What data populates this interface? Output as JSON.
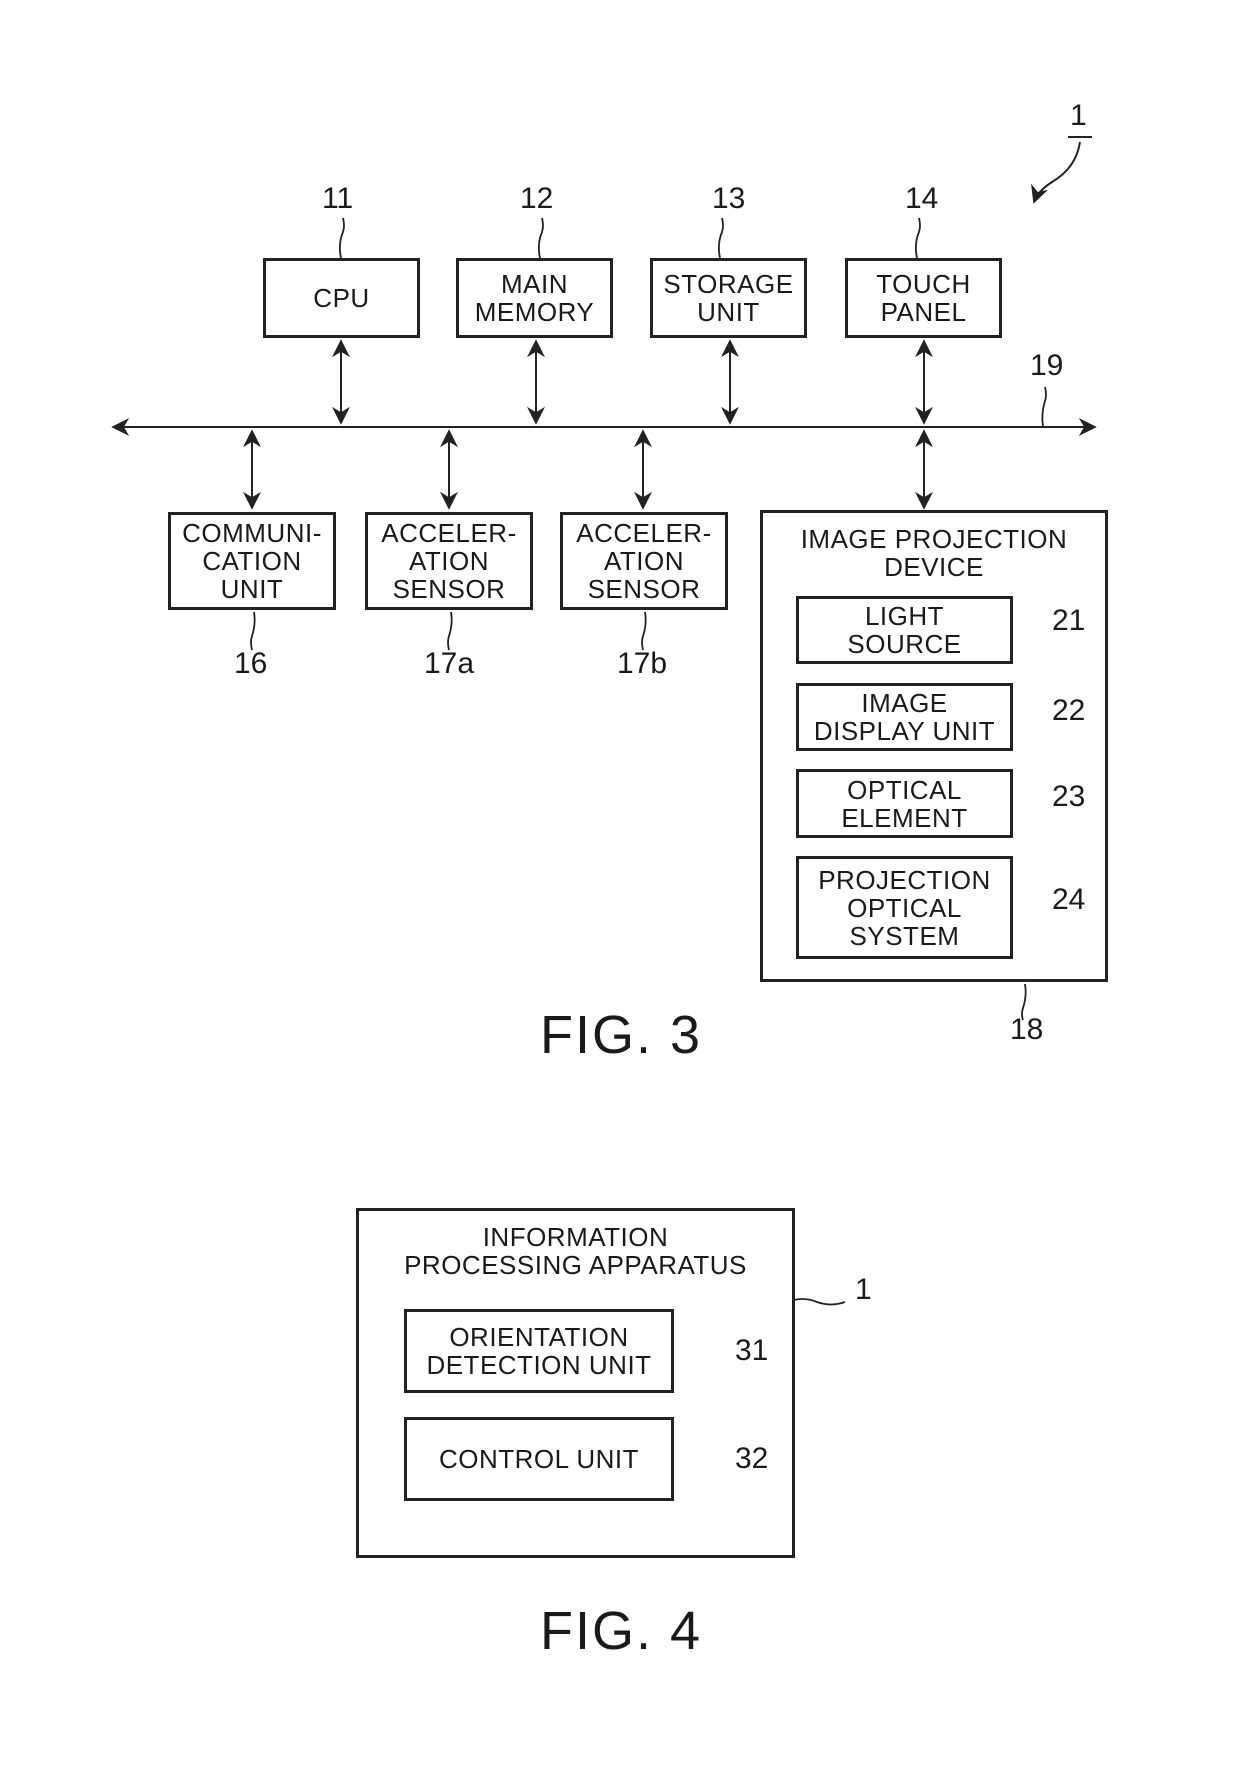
{
  "fig3": {
    "caption": "FIG. 3",
    "assembly_ref": "1",
    "bus_ref": "19",
    "top_row": [
      {
        "ref": "11",
        "label": "CPU"
      },
      {
        "ref": "12",
        "label": "MAIN\nMEMORY"
      },
      {
        "ref": "13",
        "label": "STORAGE\nUNIT"
      },
      {
        "ref": "14",
        "label": "TOUCH\nPANEL"
      }
    ],
    "bottom_row": [
      {
        "ref": "16",
        "label": "COMMUNI-\nCATION\nUNIT"
      },
      {
        "ref": "17a",
        "label": "ACCELER-\nATION\nSENSOR"
      },
      {
        "ref": "17b",
        "label": "ACCELER-\nATION\nSENSOR"
      }
    ],
    "projection_device": {
      "ref": "18",
      "title": "IMAGE PROJECTION\nDEVICE",
      "components": [
        {
          "ref": "21",
          "label": "LIGHT\nSOURCE"
        },
        {
          "ref": "22",
          "label": "IMAGE\nDISPLAY UNIT"
        },
        {
          "ref": "23",
          "label": "OPTICAL\nELEMENT"
        },
        {
          "ref": "24",
          "label": "PROJECTION\nOPTICAL\nSYSTEM"
        }
      ]
    }
  },
  "fig4": {
    "caption": "FIG. 4",
    "apparatus": {
      "ref": "1",
      "title": "INFORMATION\nPROCESSING APPARATUS",
      "components": [
        {
          "ref": "31",
          "label": "ORIENTATION\nDETECTION UNIT"
        },
        {
          "ref": "32",
          "label": "CONTROL UNIT"
        }
      ]
    }
  }
}
